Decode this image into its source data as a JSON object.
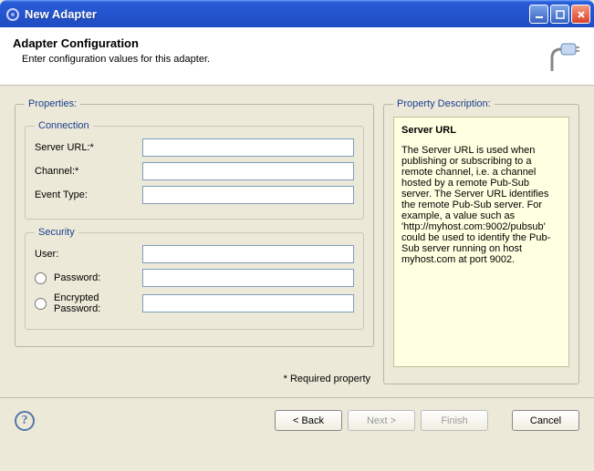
{
  "window": {
    "title": "New Adapter",
    "min_label": "_",
    "max_label": "□",
    "close_label": "X"
  },
  "header": {
    "title": "Adapter Configuration",
    "subtitle": "Enter configuration values for this adapter."
  },
  "properties": {
    "legend": "Properties:",
    "connection": {
      "legend": "Connection",
      "server_url_label": "Server URL:*",
      "server_url_value": "",
      "channel_label": "Channel:*",
      "channel_value": "",
      "event_type_label": "Event Type:",
      "event_type_value": ""
    },
    "security": {
      "legend": "Security",
      "user_label": "User:",
      "user_value": "",
      "password_label": "Password:",
      "password_value": "",
      "encrypted_label": "Encrypted Password:",
      "encrypted_value": ""
    },
    "required_note": "* Required property"
  },
  "description": {
    "legend": "Property Description:",
    "title": "Server URL",
    "body": "The Server URL is used when publishing or subscribing to a remote channel, i.e. a channel hosted by a remote Pub-Sub server.  The Server URL identifies the remote Pub-Sub server. For example, a value such as 'http://myhost.com:9002/pubsub' could be used to identify the Pub-Sub server running on host myhost.com at port 9002."
  },
  "footer": {
    "help": "?",
    "back": "< Back",
    "next": "Next >",
    "finish": "Finish",
    "cancel": "Cancel"
  }
}
